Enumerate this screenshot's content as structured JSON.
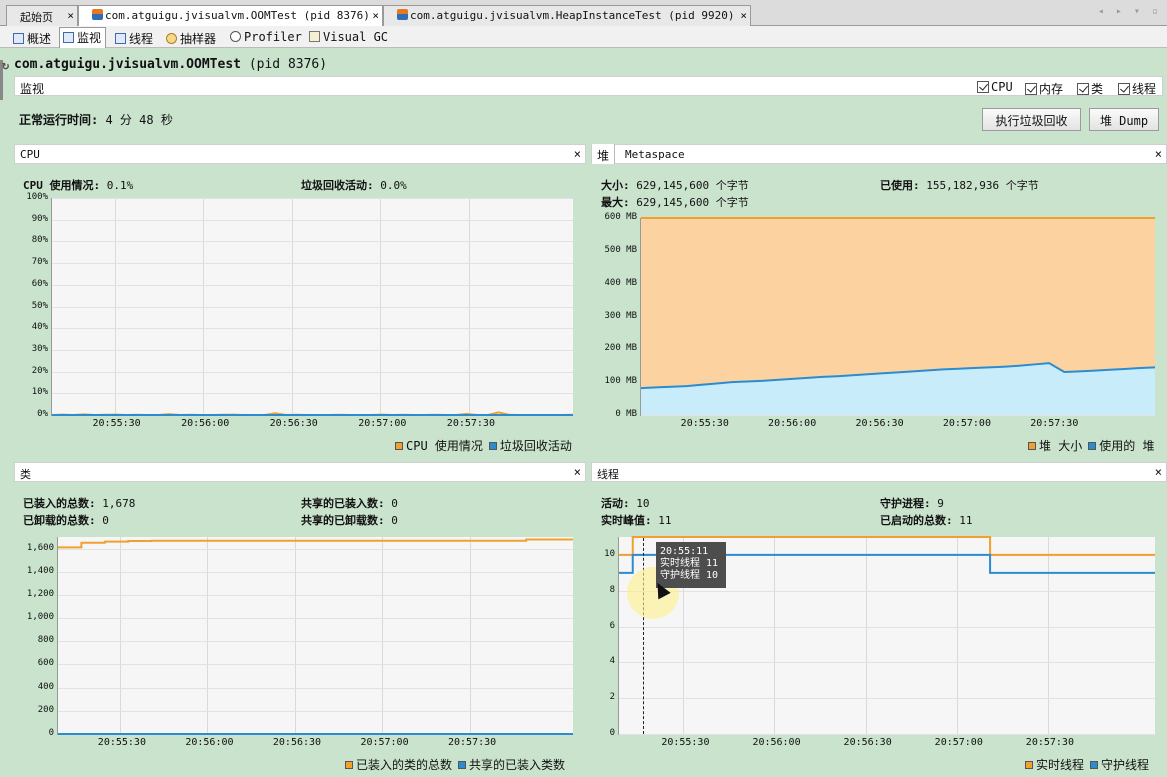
{
  "tabs": [
    {
      "label": "起始页",
      "icon": "none",
      "active": false
    },
    {
      "label": "com.atguigu.jvisualvm.OOMTest (pid 8376)",
      "icon": "java-icon",
      "active": true
    },
    {
      "label": "com.atguigu.jvisualvm.HeapInstanceTest (pid 9920)",
      "icon": "java-icon",
      "active": false
    }
  ],
  "close_glyph": "×",
  "nav_arrows": "◂ ▸ ▾ ▫",
  "subtabs": [
    {
      "label": "概述",
      "icon": "overview-icon"
    },
    {
      "label": "监视",
      "icon": "monitor-icon",
      "active": true
    },
    {
      "label": "线程",
      "icon": "threads-icon"
    },
    {
      "label": "抽样器",
      "icon": "sampler-icon"
    },
    {
      "label": "Profiler",
      "icon": "profiler-icon"
    },
    {
      "label": "Visual GC",
      "icon": "visualgc-icon"
    }
  ],
  "app": {
    "name": "com.atguigu.jvisualvm.OOMTest",
    "pid": "(pid 8376)"
  },
  "monitor_bar": {
    "label": "监视",
    "checks": [
      "CPU",
      "内存",
      "类",
      "线程"
    ]
  },
  "uptime": {
    "label": "正常运行时间:",
    "value": "4 分 48 秒"
  },
  "buttons": {
    "gc": "执行垃圾回收",
    "heap_dump": "堆 Dump"
  },
  "panels": {
    "cpu": {
      "title": "CPU",
      "usage_label": "CPU 使用情况:",
      "usage_value": "0.1%",
      "gc_label": "垃圾回收活动:",
      "gc_value": "0.0%",
      "legend": [
        "CPU 使用情况",
        "垃圾回收活动"
      ]
    },
    "heap": {
      "tab1": "堆",
      "tab2": "Metaspace",
      "size_label": "大小:",
      "size_value": "629,145,600 个字节",
      "used_label": "已使用:",
      "used_value": "155,182,936 个字节",
      "max_label": "最大:",
      "max_value": "629,145,600 个字节",
      "legend": [
        "堆 大小",
        "使用的 堆"
      ]
    },
    "classes": {
      "title": "类",
      "loaded_label": "已装入的总数:",
      "loaded_value": "1,678",
      "shared_loaded_label": "共享的已装入数:",
      "shared_loaded_value": "0",
      "unloaded_label": "已卸载的总数:",
      "unloaded_value": "0",
      "shared_unloaded_label": "共享的已卸载数:",
      "shared_unloaded_value": "0",
      "legend": [
        "已装入的类的总数",
        "共享的已装入类数"
      ]
    },
    "threads": {
      "title": "线程",
      "live_label": "活动:",
      "live_value": "10",
      "daemon_label": "守护进程:",
      "daemon_value": "9",
      "peak_label": "实时峰值:",
      "peak_value": "11",
      "started_label": "已启动的总数:",
      "started_value": "11",
      "legend": [
        "实时线程",
        "守护线程"
      ],
      "tooltip": {
        "time": "20:55:11",
        "live": "实时线程 11",
        "daemon": "守护线程 10"
      }
    }
  },
  "chart_data": [
    {
      "type": "line",
      "name": "cpu",
      "y_ticks": [
        "100%",
        "90%",
        "80%",
        "70%",
        "60%",
        "50%",
        "40%",
        "30%",
        "20%",
        "10%",
        "0%"
      ],
      "x_ticks": [
        "20:55:30",
        "20:56:00",
        "20:56:30",
        "20:57:00",
        "20:57:30"
      ],
      "ylim": [
        0,
        100
      ],
      "series": [
        {
          "name": "CPU 使用情况",
          "color": "#f0a030",
          "values": [
            0,
            0.2,
            0,
            0.3,
            0,
            0.1,
            0.2,
            0,
            0.1,
            0,
            0,
            0.4,
            0,
            0.1,
            0,
            0,
            0.1,
            0.2,
            0,
            0,
            0,
            0.8,
            0,
            0.1,
            0,
            0,
            0,
            0.1,
            0,
            0,
            0,
            0.2,
            0,
            0.1,
            0,
            0,
            0.1,
            0,
            0,
            0.5,
            0,
            0,
            1.2,
            0.1,
            0,
            0,
            0,
            0,
            0,
            0.1
          ]
        },
        {
          "name": "垃圾回收活动",
          "color": "#2b8ccf",
          "values": [
            0,
            0,
            0,
            0,
            0,
            0,
            0,
            0,
            0,
            0
          ]
        }
      ]
    },
    {
      "type": "area",
      "name": "heap",
      "y_ticks": [
        "600 MB",
        "500 MB",
        "400 MB",
        "300 MB",
        "200 MB",
        "100 MB",
        "0 MB"
      ],
      "x_ticks": [
        "20:55:30",
        "20:56:00",
        "20:56:30",
        "20:57:00",
        "20:57:30"
      ],
      "ylim": [
        0,
        600
      ],
      "series": [
        {
          "name": "堆 大小",
          "color": "#f0a030",
          "values": [
            600,
            600
          ]
        },
        {
          "name": "使用的 堆",
          "color": "#2b8ccf",
          "values": [
            82,
            84,
            86,
            88,
            92,
            96,
            100,
            102,
            104,
            107,
            110,
            113,
            116,
            118,
            121,
            124,
            127,
            130,
            133,
            136,
            139,
            141,
            143,
            145,
            147,
            150,
            154,
            158,
            131,
            133,
            135,
            138,
            140,
            143,
            145
          ]
        }
      ]
    },
    {
      "type": "line",
      "name": "classes",
      "y_ticks": [
        "1,600",
        "1,400",
        "1,200",
        "1,000",
        "800",
        "600",
        "400",
        "200",
        "0"
      ],
      "x_ticks": [
        "20:55:30",
        "20:56:00",
        "20:56:30",
        "20:57:00",
        "20:57:30"
      ],
      "ylim": [
        0,
        1700
      ],
      "series": [
        {
          "name": "已装入的类的总数",
          "color": "#f0a030",
          "values": [
            1610,
            1650,
            1660,
            1665,
            1668,
            1668,
            1668,
            1668,
            1668,
            1668,
            1668,
            1668,
            1668,
            1668,
            1668,
            1668,
            1668,
            1668,
            1668,
            1668,
            1678,
            1678,
            1678
          ]
        },
        {
          "name": "共享的已装入类数",
          "color": "#2b8ccf",
          "values": [
            0,
            0
          ]
        }
      ]
    },
    {
      "type": "line",
      "name": "threads",
      "y_ticks": [
        "10",
        "8",
        "6",
        "4",
        "2",
        "0"
      ],
      "x_ticks": [
        "20:55:30",
        "20:56:00",
        "20:56:30",
        "20:57:00",
        "20:57:30"
      ],
      "ylim": [
        0,
        11
      ],
      "series": [
        {
          "name": "实时线程",
          "color": "#f0a030",
          "values": [
            10,
            11,
            11,
            11,
            11,
            11,
            11,
            11,
            11,
            11,
            11,
            11,
            11,
            11,
            11,
            11,
            11,
            11,
            11,
            11,
            11,
            11,
            11,
            11,
            11,
            11,
            11,
            10,
            10,
            10,
            10,
            10,
            10,
            10,
            10,
            10,
            10,
            10,
            10,
            10
          ]
        },
        {
          "name": "守护线程",
          "color": "#2b8ccf",
          "values": [
            9,
            10,
            10,
            10,
            10,
            10,
            10,
            10,
            10,
            10,
            10,
            10,
            10,
            10,
            10,
            10,
            10,
            10,
            10,
            10,
            10,
            10,
            10,
            10,
            10,
            10,
            10,
            9,
            9,
            9,
            9,
            9,
            9,
            9,
            9,
            9,
            9,
            9,
            9,
            9
          ]
        }
      ]
    }
  ]
}
